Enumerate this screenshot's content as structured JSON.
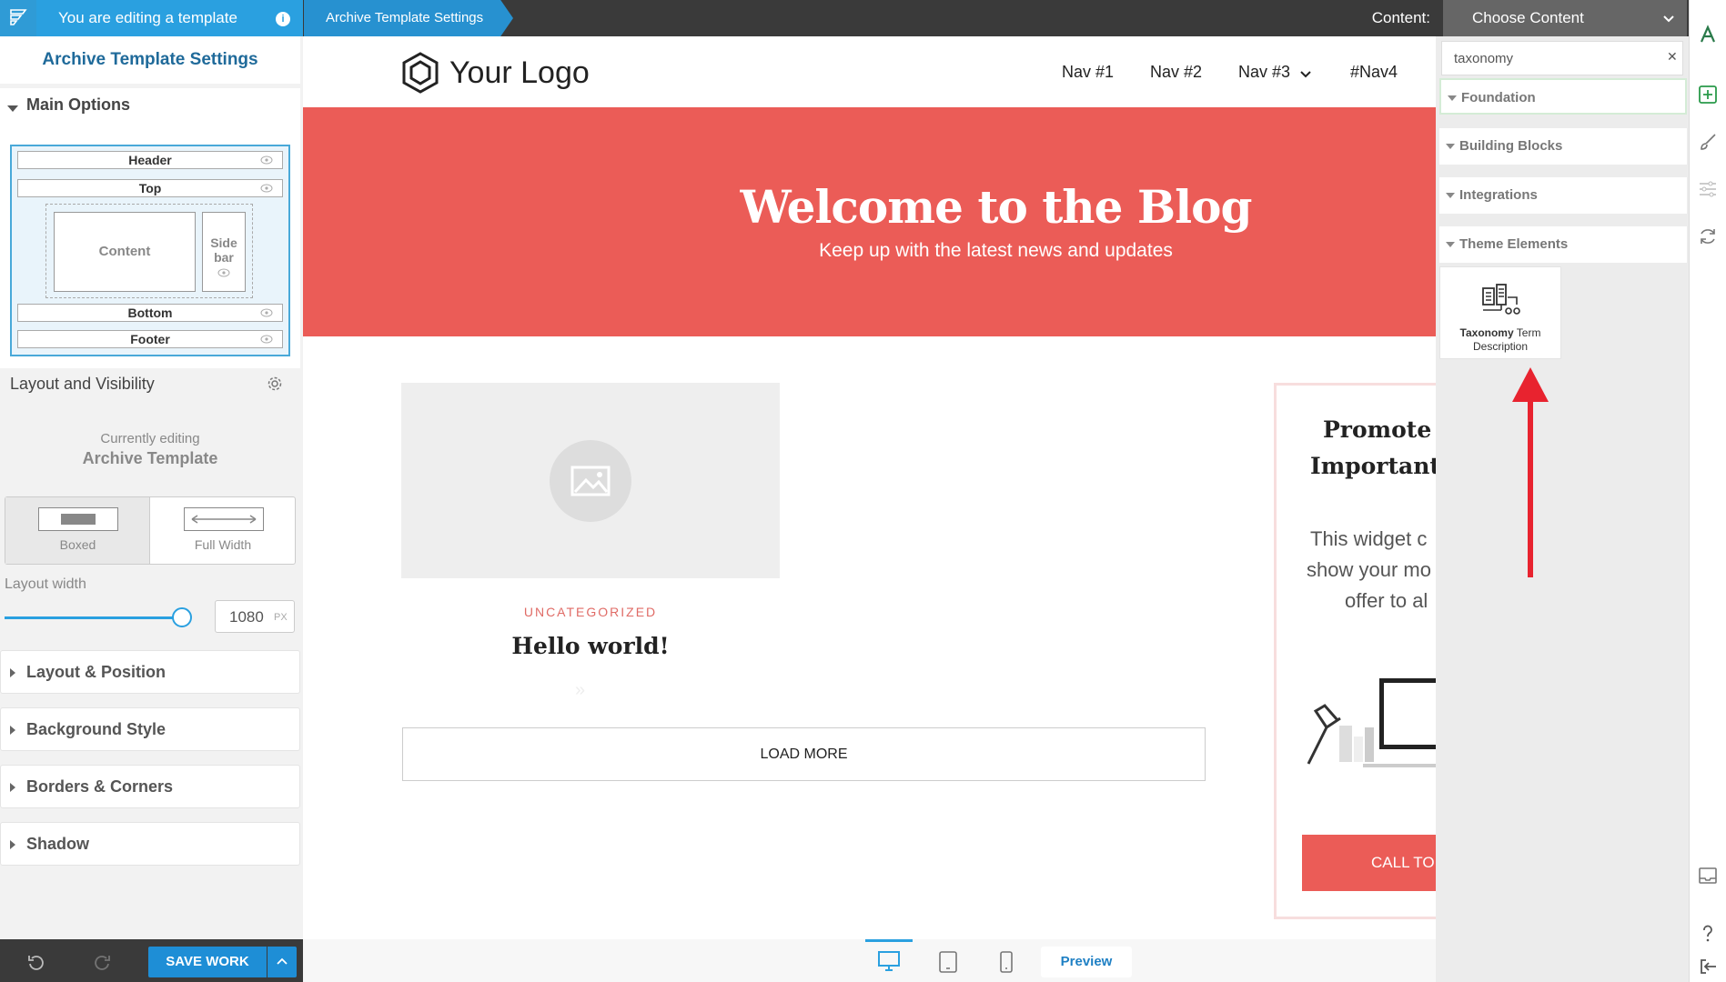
{
  "topbar": {
    "editing_label": "You are editing a template",
    "breadcrumb": "Archive Template Settings",
    "content_label": "Content:",
    "content_select": "Choose Content"
  },
  "left_panel": {
    "title": "Archive Template Settings",
    "main_options": "Main Options",
    "layout": {
      "header": "Header",
      "top": "Top",
      "content": "Content",
      "sidebar_line1": "Side",
      "sidebar_line2": "bar",
      "bottom": "Bottom",
      "footer": "Footer"
    },
    "layout_visibility": "Layout and Visibility",
    "currently_editing": "Currently editing",
    "template_name": "Archive Template",
    "toggle": {
      "boxed": "Boxed",
      "full": "Full Width",
      "selected": "Boxed"
    },
    "layout_width_label": "Layout width",
    "layout_width_value": "1080",
    "layout_width_unit": "PX",
    "layout_width_fraction": 0.82,
    "sections": [
      "Layout & Position",
      "Background Style",
      "Borders & Corners",
      "Shadow"
    ],
    "save_label": "SAVE WORK"
  },
  "site": {
    "logo_text": "Your Logo",
    "nav": [
      "Nav #1",
      "Nav #2",
      "Nav #3",
      "#Nav4"
    ],
    "hero_title": "Welcome to the Blog",
    "hero_subtitle": "Keep up with the latest news and updates",
    "post_category": "UNCATEGORIZED",
    "post_title": "Hello world!",
    "post_more": "»",
    "load_more": "LOAD MORE",
    "widget": {
      "title_line1": "Promote Y",
      "title_line2": "Important",
      "body_line1": "This widget c",
      "body_line2": "show your mo",
      "body_line3": "offer to al",
      "cta": "CALL TO"
    },
    "accent_color": "#eb5c57"
  },
  "bottom_toolbar": {
    "active_device": "desktop",
    "preview": "Preview"
  },
  "right_panel": {
    "search_value": "taxonomy",
    "categories": [
      "Foundation",
      "Building Blocks",
      "Integrations",
      "Theme Elements"
    ],
    "element_bold": "Taxonomy",
    "element_rest": " Term Description"
  },
  "colors": {
    "primary": "#2aa0e0",
    "save": "#1e8ed6",
    "arrow": "#e8232f"
  },
  "icons": [
    "kadence-logo-icon",
    "info-icon",
    "chevron-down-icon",
    "eye-icon",
    "gear-icon",
    "undo-icon",
    "redo-icon",
    "hexagon-logo-icon",
    "image-placeholder-icon",
    "desktop-icon",
    "tablet-icon",
    "phone-icon",
    "taxonomy-term-icon",
    "add-block-icon",
    "brush-icon",
    "sliders-icon",
    "sync-icon",
    "inbox-icon",
    "help-icon",
    "exit-icon"
  ]
}
